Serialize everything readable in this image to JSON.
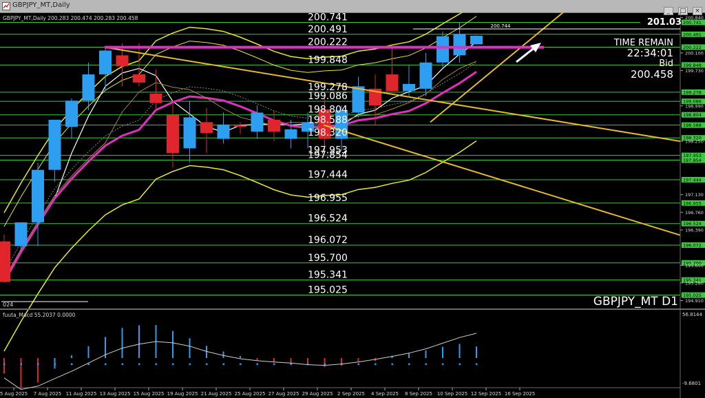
{
  "window": {
    "title": "GBPJPY_MT,Daily",
    "min_glyph": "_",
    "max_glyph": "□",
    "close_glyph": "×"
  },
  "chart_info": {
    "header": "GBPJPY_MT,Daily  200.283 200.474 200.283 200.458",
    "symbol_label": "GBPJPY_MT D1",
    "corner_text": "024",
    "price_top": "201.03",
    "time_remain_label": "TIME REMAIN",
    "time_remain_value": "22:34:01",
    "bid_label": "Bid",
    "bid_value": "200.458",
    "hline_value_top": "200.744"
  },
  "macd": {
    "label": "fuuta_Macd 55.2037  0.0000",
    "scale_top": "56.8144",
    "scale_bottom": "-9.6801"
  },
  "colors": {
    "bull": "#2e9ef0",
    "bear": "#e0262c",
    "band": "#e8e82e",
    "trend": "#e4bb2c",
    "magenta": "#e030c0",
    "hline": "#3ec83e",
    "grid_text": "#ffffff",
    "axis_text": "#d8d8d8"
  },
  "chart_data": {
    "type": "candlestick",
    "title": "GBPJPY_MT,Daily",
    "xlabel": "",
    "ylabel": "",
    "ylim": [
      194.73,
      200.95
    ],
    "x_ticks": [
      "5 Aug 2025",
      "7 Aug 2025",
      "11 Aug 2025",
      "13 Aug 2025",
      "15 Aug 2025",
      "19 Aug 2025",
      "21 Aug 2025",
      "25 Aug 2025",
      "27 Aug 2025",
      "29 Aug 2025",
      "2 Sep 2025",
      "4 Sep 2025",
      "8 Sep 2025",
      "10 Sep 2025",
      "12 Sep 2025",
      "16 Sep 2025"
    ],
    "y_axis_ticks": [
      "200.840",
      "200.100",
      "199.730",
      "198.990",
      "198.250",
      "197.130",
      "196.760",
      "196.390",
      "195.650",
      "195.280",
      "194.910"
    ],
    "levels": [
      {
        "label": "200.741",
        "value": 200.741
      },
      {
        "label": "200.491",
        "value": 200.491
      },
      {
        "label": "200.222",
        "value": 200.222
      },
      {
        "label": "199.848",
        "value": 199.848
      },
      {
        "label": "199.278",
        "value": 199.278
      },
      {
        "label": "199.086",
        "value": 199.086
      },
      {
        "label": "198.804",
        "value": 198.804
      },
      {
        "label": "198.588",
        "value": 198.588
      },
      {
        "label": "198.320",
        "value": 198.32
      },
      {
        "label": "197.953",
        "value": 197.953
      },
      {
        "label": "197.854",
        "value": 197.854
      },
      {
        "label": "197.444",
        "value": 197.444
      },
      {
        "label": "196.955",
        "value": 196.955
      },
      {
        "label": "196.524",
        "value": 196.524
      },
      {
        "label": "196.072",
        "value": 196.072
      },
      {
        "label": "195.700",
        "value": 195.7
      },
      {
        "label": "195.341",
        "value": 195.341
      },
      {
        "label": "195.025",
        "value": 195.025
      }
    ],
    "candles": [
      {
        "o": 196.15,
        "h": 196.3,
        "l": 195.3,
        "c": 195.3
      },
      {
        "o": 196.05,
        "h": 196.55,
        "l": 195.95,
        "c": 196.55
      },
      {
        "o": 196.55,
        "h": 197.8,
        "l": 196.05,
        "c": 197.65
      },
      {
        "o": 197.65,
        "h": 198.7,
        "l": 197.4,
        "c": 198.7
      },
      {
        "o": 198.55,
        "h": 199.15,
        "l": 198.3,
        "c": 199.1
      },
      {
        "o": 199.1,
        "h": 199.9,
        "l": 198.9,
        "c": 199.65
      },
      {
        "o": 199.65,
        "h": 200.2,
        "l": 199.3,
        "c": 200.15
      },
      {
        "o": 200.05,
        "h": 200.3,
        "l": 199.4,
        "c": 199.82
      },
      {
        "o": 199.65,
        "h": 200.3,
        "l": 199.4,
        "c": 199.48
      },
      {
        "o": 199.25,
        "h": 199.75,
        "l": 198.9,
        "c": 199.05
      },
      {
        "o": 198.8,
        "h": 199.1,
        "l": 197.7,
        "c": 198.0
      },
      {
        "o": 198.1,
        "h": 199.1,
        "l": 197.8,
        "c": 198.75
      },
      {
        "o": 198.65,
        "h": 198.95,
        "l": 198.0,
        "c": 198.42
      },
      {
        "o": 198.3,
        "h": 198.85,
        "l": 198.2,
        "c": 198.6
      },
      {
        "o": 198.58,
        "h": 198.65,
        "l": 198.4,
        "c": 198.55
      },
      {
        "o": 198.45,
        "h": 199.0,
        "l": 198.3,
        "c": 198.85
      },
      {
        "o": 198.7,
        "h": 198.9,
        "l": 198.25,
        "c": 198.45
      },
      {
        "o": 198.3,
        "h": 198.7,
        "l": 198.1,
        "c": 198.5
      },
      {
        "o": 198.45,
        "h": 198.85,
        "l": 198.1,
        "c": 198.65
      },
      {
        "o": 198.92,
        "h": 199.15,
        "l": 198.05,
        "c": 198.3
      },
      {
        "o": 198.3,
        "h": 199.0,
        "l": 198.05,
        "c": 198.9
      },
      {
        "o": 198.85,
        "h": 199.6,
        "l": 198.75,
        "c": 199.4
      },
      {
        "o": 199.35,
        "h": 199.65,
        "l": 198.6,
        "c": 199.0
      },
      {
        "o": 199.65,
        "h": 200.2,
        "l": 199.3,
        "c": 199.3
      },
      {
        "o": 199.3,
        "h": 199.85,
        "l": 199.2,
        "c": 199.45
      },
      {
        "o": 199.35,
        "h": 200.1,
        "l": 199.2,
        "c": 199.9
      },
      {
        "o": 199.9,
        "h": 200.55,
        "l": 199.8,
        "c": 200.45
      },
      {
        "o": 200.05,
        "h": 200.75,
        "l": 199.9,
        "c": 200.5
      },
      {
        "o": 200.28,
        "h": 200.47,
        "l": 200.28,
        "c": 200.46
      }
    ],
    "macd_histogram": [
      -0.47,
      -0.93,
      -0.74,
      -0.32,
      0.08,
      0.36,
      0.64,
      0.91,
      0.99,
      1.0,
      0.82,
      0.6,
      0.37,
      0.2,
      0.06,
      -0.07,
      -0.12,
      -0.16,
      -0.2,
      -0.27,
      -0.23,
      -0.12,
      -0.09,
      0.07,
      0.14,
      0.23,
      0.34,
      0.43,
      0.35
    ],
    "macd_signal": [
      -0.18,
      -0.18,
      -0.18,
      -0.18,
      -0.18,
      -0.18,
      -0.18,
      -0.18,
      -0.18,
      -0.18,
      -0.18,
      -0.18,
      -0.18,
      -0.18,
      -0.18,
      -0.18,
      -0.18,
      -0.18,
      -0.18,
      -0.18,
      -0.18,
      -0.18,
      -0.18,
      -0.18,
      -0.18,
      -0.18,
      -0.18,
      -0.18,
      -0.18
    ],
    "macd_line": [
      -0.6,
      -0.95,
      -0.85,
      -0.62,
      -0.4,
      -0.15,
      0.1,
      0.3,
      0.42,
      0.5,
      0.46,
      0.36,
      0.2,
      0.08,
      -0.02,
      -0.08,
      -0.12,
      -0.15,
      -0.2,
      -0.22,
      -0.18,
      -0.12,
      -0.04,
      0.05,
      0.15,
      0.28,
      0.45,
      0.62,
      0.75
    ]
  }
}
